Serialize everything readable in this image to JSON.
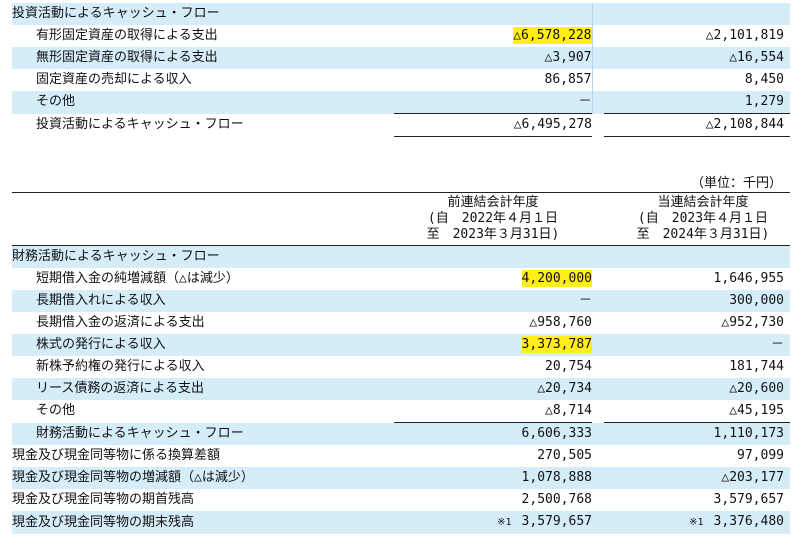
{
  "investing": {
    "section_title": "投資活動によるキャッシュ・フロー",
    "rows": [
      {
        "label": "有形固定資産の取得による支出",
        "prev": "△6,578,228",
        "cur": "△2,101,819",
        "highlight_prev": true
      },
      {
        "label": "無形固定資産の取得による支出",
        "prev": "△3,907",
        "cur": "△16,554"
      },
      {
        "label": "固定資産の売却による収入",
        "prev": "86,857",
        "cur": "8,450"
      },
      {
        "label": "その他",
        "prev": "－",
        "cur": "1,279"
      }
    ],
    "total": {
      "label": "投資活動によるキャッシュ・フロー",
      "prev": "△6,495,278",
      "cur": "△2,108,844"
    }
  },
  "unit": "（単位：千円）",
  "periods": {
    "prev": {
      "name": "前連結会計年度",
      "from": "(自　2022年４月１日",
      "to": "至　2023年３月31日)"
    },
    "cur": {
      "name": "当連結会計年度",
      "from": "(自　2023年４月１日",
      "to": "至　2024年３月31日)"
    }
  },
  "financing": {
    "section_title": "財務活動によるキャッシュ・フロー",
    "rows": [
      {
        "label": "短期借入金の純増減額（△は減少）",
        "prev": "4,200,000",
        "cur": "1,646,955",
        "highlight_prev": true
      },
      {
        "label": "長期借入れによる収入",
        "prev": "－",
        "cur": "300,000"
      },
      {
        "label": "長期借入金の返済による支出",
        "prev": "△958,760",
        "cur": "△952,730"
      },
      {
        "label": "株式の発行による収入",
        "prev": "3,373,787",
        "cur": "－",
        "highlight_prev": true
      },
      {
        "label": "新株予約権の発行による収入",
        "prev": "20,754",
        "cur": "181,744"
      },
      {
        "label": "リース債務の返済による支出",
        "prev": "△20,734",
        "cur": "△20,600"
      },
      {
        "label": "その他",
        "prev": "△8,714",
        "cur": "△45,195"
      }
    ],
    "total": {
      "label": "財務活動によるキャッシュ・フロー",
      "prev": "6,606,333",
      "cur": "1,110,173"
    }
  },
  "summary": [
    {
      "label": "現金及び現金同等物に係る換算差額",
      "prev": "270,505",
      "cur": "97,099"
    },
    {
      "label": "現金及び現金同等物の増減額（△は減少）",
      "prev": "1,078,888",
      "cur": "△203,177"
    },
    {
      "label": "現金及び現金同等物の期首残高",
      "prev": "2,500,768",
      "cur": "3,579,657"
    },
    {
      "label": "現金及び現金同等物の期末残高",
      "prev": "3,579,657",
      "cur": "3,376,480",
      "note_prev": "※1",
      "note_cur": "※1"
    }
  ]
}
